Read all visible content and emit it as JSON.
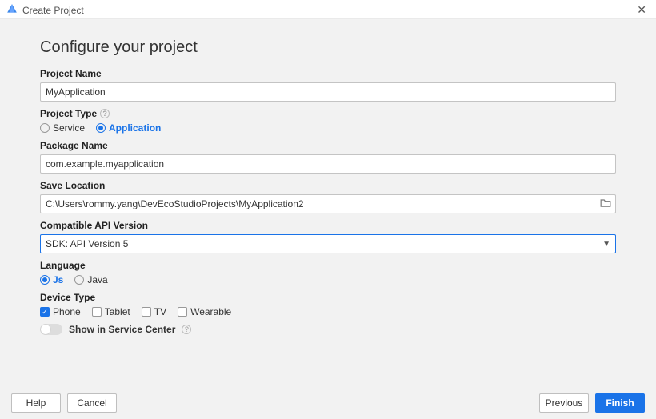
{
  "window": {
    "title": "Create Project"
  },
  "heading": "Configure your project",
  "labels": {
    "projectName": "Project Name",
    "projectType": "Project Type",
    "packageName": "Package Name",
    "saveLocation": "Save Location",
    "apiVersion": "Compatible API Version",
    "language": "Language",
    "deviceType": "Device Type",
    "showService": "Show in Service Center"
  },
  "values": {
    "projectName": "MyApplication",
    "packageName": "com.example.myapplication",
    "saveLocation": "C:\\Users\\rommy.yang\\DevEcoStudioProjects\\MyApplication2",
    "apiVersion": "SDK: API Version 5"
  },
  "projectType": {
    "options": [
      "Service",
      "Application"
    ],
    "selected": "Application"
  },
  "language": {
    "options": [
      "Js",
      "Java"
    ],
    "selected": "Js"
  },
  "deviceType": {
    "options": [
      "Phone",
      "Tablet",
      "TV",
      "Wearable"
    ],
    "checked": [
      "Phone"
    ]
  },
  "showInServiceCenter": false,
  "buttons": {
    "help": "Help",
    "cancel": "Cancel",
    "previous": "Previous",
    "finish": "Finish"
  }
}
